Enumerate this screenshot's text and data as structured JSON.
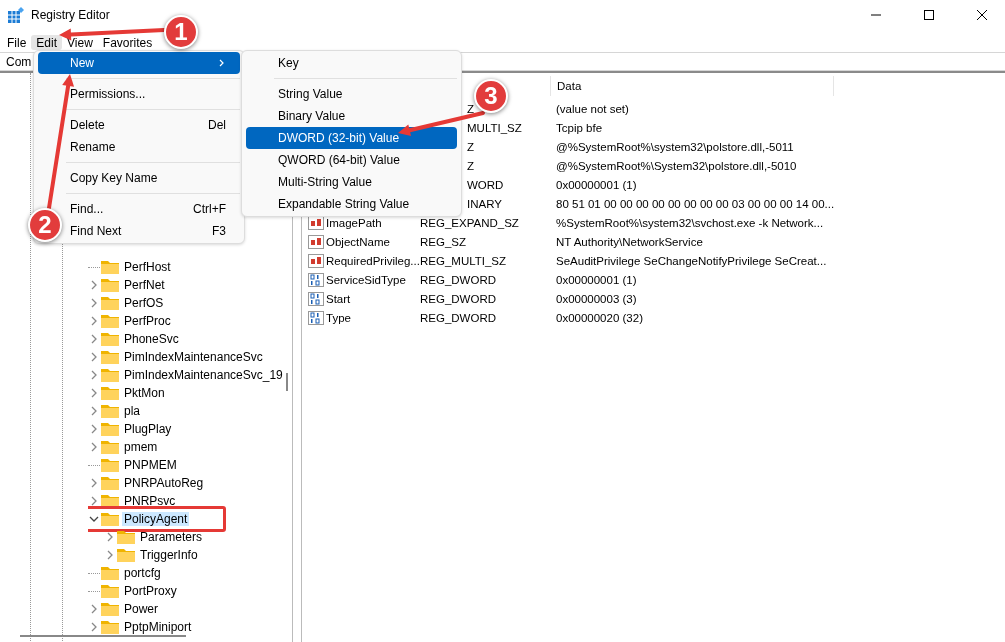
{
  "window": {
    "title": "Registry Editor"
  },
  "menu_bar": [
    {
      "label": "File",
      "selected": false
    },
    {
      "label": "Edit",
      "selected": true
    },
    {
      "label": "View",
      "selected": false
    },
    {
      "label": "Favorites",
      "selected": false
    }
  ],
  "address_bar": {
    "value": "Com"
  },
  "tree": [
    {
      "label": "PerfHost",
      "has_children": false,
      "expanded": false,
      "selected": false,
      "annotated": false
    },
    {
      "label": "PerfNet",
      "has_children": true,
      "expanded": false,
      "selected": false,
      "annotated": false
    },
    {
      "label": "PerfOS",
      "has_children": true,
      "expanded": false,
      "selected": false,
      "annotated": false
    },
    {
      "label": "PerfProc",
      "has_children": true,
      "expanded": false,
      "selected": false,
      "annotated": false
    },
    {
      "label": "PhoneSvc",
      "has_children": true,
      "expanded": false,
      "selected": false,
      "annotated": false
    },
    {
      "label": "PimIndexMaintenanceSvc",
      "has_children": true,
      "expanded": false,
      "selected": false,
      "annotated": false
    },
    {
      "label": "PimIndexMaintenanceSvc_19",
      "has_children": true,
      "expanded": false,
      "selected": false,
      "annotated": false
    },
    {
      "label": "PktMon",
      "has_children": true,
      "expanded": false,
      "selected": false,
      "annotated": false
    },
    {
      "label": "pla",
      "has_children": true,
      "expanded": false,
      "selected": false,
      "annotated": false
    },
    {
      "label": "PlugPlay",
      "has_children": true,
      "expanded": false,
      "selected": false,
      "annotated": false
    },
    {
      "label": "pmem",
      "has_children": true,
      "expanded": false,
      "selected": false,
      "annotated": false
    },
    {
      "label": "PNPMEM",
      "has_children": false,
      "expanded": false,
      "selected": false,
      "annotated": false
    },
    {
      "label": "PNRPAutoReg",
      "has_children": true,
      "expanded": false,
      "selected": false,
      "annotated": false
    },
    {
      "label": "PNRPsvc",
      "has_children": true,
      "expanded": false,
      "selected": false,
      "annotated": false
    },
    {
      "label": "PolicyAgent",
      "has_children": true,
      "expanded": true,
      "selected": true,
      "annotated": true,
      "children": [
        {
          "label": "Parameters",
          "has_children": true,
          "expanded": false,
          "selected": false,
          "annotated": false
        },
        {
          "label": "TriggerInfo",
          "has_children": true,
          "expanded": false,
          "selected": false,
          "annotated": false
        }
      ]
    },
    {
      "label": "portcfg",
      "has_children": false,
      "expanded": false,
      "selected": false,
      "annotated": false
    },
    {
      "label": "PortProxy",
      "has_children": false,
      "expanded": false,
      "selected": false,
      "annotated": false
    },
    {
      "label": "Power",
      "has_children": true,
      "expanded": false,
      "selected": false,
      "annotated": false
    },
    {
      "label": "PptpMiniport",
      "has_children": true,
      "expanded": false,
      "selected": false,
      "annotated": false
    }
  ],
  "values": {
    "data_header": "Data",
    "rows": [
      {
        "type": "Z",
        "data": "(value not set)"
      },
      {
        "type": "MULTI_SZ",
        "data": "Tcpip bfe"
      },
      {
        "type": "Z",
        "data": "@%SystemRoot%\\system32\\polstore.dll,-5011"
      },
      {
        "type": "Z",
        "data": "@%SystemRoot%\\System32\\polstore.dll,-5010"
      },
      {
        "type": "WORD",
        "data": "0x00000001 (1)"
      },
      {
        "type": "INARY",
        "data": "80 51 01 00 00 00 00 00 00 00 00 03 00 00 00 14 00..."
      },
      {
        "kind": "string",
        "name": "ImagePath",
        "type": "REG_EXPAND_SZ",
        "data": "%SystemRoot%\\system32\\svchost.exe -k Network..."
      },
      {
        "kind": "string",
        "name": "ObjectName",
        "type": "REG_SZ",
        "data": "NT Authority\\NetworkService"
      },
      {
        "kind": "string",
        "name": "RequiredPrivileg...",
        "type": "REG_MULTI_SZ",
        "data": "SeAuditPrivilege SeChangeNotifyPrivilege SeCreat..."
      },
      {
        "kind": "binary",
        "name": "ServiceSidType",
        "type": "REG_DWORD",
        "data": "0x00000001 (1)"
      },
      {
        "kind": "binary",
        "name": "Start",
        "type": "REG_DWORD",
        "data": "0x00000003 (3)"
      },
      {
        "kind": "binary",
        "name": "Type",
        "type": "REG_DWORD",
        "data": "0x00000020 (32)"
      }
    ]
  },
  "edit_menu": {
    "items": [
      {
        "kind": "item",
        "label": "New",
        "has_submenu": true,
        "selected": true
      },
      {
        "kind": "separator"
      },
      {
        "kind": "item",
        "label": "Permissions...",
        "has_submenu": false,
        "selected": false
      },
      {
        "kind": "separator"
      },
      {
        "kind": "item",
        "label": "Delete",
        "shortcut": "Del",
        "has_submenu": false,
        "selected": false
      },
      {
        "kind": "item",
        "label": "Rename",
        "has_submenu": false,
        "selected": false
      },
      {
        "kind": "separator"
      },
      {
        "kind": "item",
        "label": "Copy Key Name",
        "has_submenu": false,
        "selected": false
      },
      {
        "kind": "separator"
      },
      {
        "kind": "item",
        "label": "Find...",
        "shortcut": "Ctrl+F",
        "has_submenu": false,
        "selected": false
      },
      {
        "kind": "item",
        "label": "Find Next",
        "shortcut": "F3",
        "has_submenu": false,
        "selected": false
      }
    ]
  },
  "new_submenu": {
    "items": [
      {
        "kind": "item",
        "label": "Key",
        "selected": false
      },
      {
        "kind": "separator"
      },
      {
        "kind": "item",
        "label": "String Value",
        "selected": false
      },
      {
        "kind": "item",
        "label": "Binary Value",
        "selected": false
      },
      {
        "kind": "item",
        "label": "DWORD (32-bit) Value",
        "selected": true
      },
      {
        "kind": "item",
        "label": "QWORD (64-bit) Value",
        "selected": false
      },
      {
        "kind": "item",
        "label": "Multi-String Value",
        "selected": false
      },
      {
        "kind": "item",
        "label": "Expandable String Value",
        "selected": false
      }
    ]
  },
  "annotations": [
    {
      "number": "1"
    },
    {
      "number": "2"
    },
    {
      "number": "3"
    }
  ]
}
